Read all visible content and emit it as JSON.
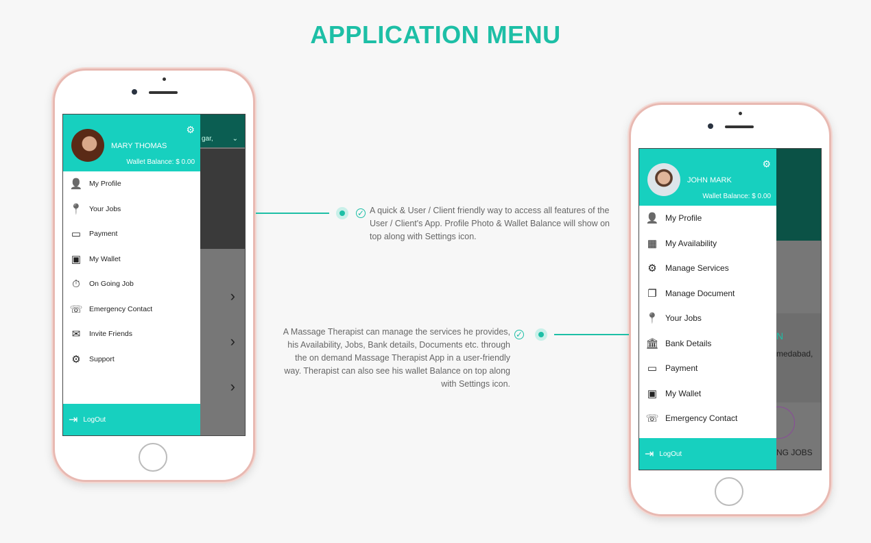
{
  "title": "APPLICATION MENU",
  "colors": {
    "accent": "#17d0bf",
    "title": "#1dbfa6"
  },
  "left_phone": {
    "user_name": "MARY THOMAS",
    "wallet_balance": "Wallet Balance: $ 0.00",
    "settings_icon": "gear-icon",
    "bg_location": "gar,",
    "items": [
      {
        "label": "My Profile",
        "icon": "user-icon"
      },
      {
        "label": "Your Jobs",
        "icon": "map-pin-icon"
      },
      {
        "label": "Payment",
        "icon": "credit-card-icon"
      },
      {
        "label": "My Wallet",
        "icon": "wallet-icon"
      },
      {
        "label": "On Going Job",
        "icon": "stopwatch-icon"
      },
      {
        "label": "Emergency Contact",
        "icon": "phonebook-icon"
      },
      {
        "label": "Invite Friends",
        "icon": "envelope-icon"
      },
      {
        "label": "Support",
        "icon": "support-icon"
      }
    ],
    "logout": "LogOut"
  },
  "right_phone": {
    "user_name": "JOHN MARK",
    "wallet_balance": "Wallet Balance: $ 0.00",
    "settings_icon": "gear-icon",
    "bg_text1": "N",
    "bg_text2": "medabad,",
    "bg_text3": "NG JOBS",
    "items": [
      {
        "label": "My Profile",
        "icon": "user-icon"
      },
      {
        "label": "My Availability",
        "icon": "calendar-icon"
      },
      {
        "label": "Manage Services",
        "icon": "gear-wrench-icon"
      },
      {
        "label": "Manage Document",
        "icon": "document-icon"
      },
      {
        "label": "Your Jobs",
        "icon": "map-pin-icon"
      },
      {
        "label": "Bank Details",
        "icon": "bank-icon"
      },
      {
        "label": "Payment",
        "icon": "credit-card-icon"
      },
      {
        "label": "My Wallet",
        "icon": "wallet-icon"
      },
      {
        "label": "Emergency Contact",
        "icon": "phonebook-icon"
      }
    ],
    "logout": "LogOut"
  },
  "notes": {
    "left": "A quick & User / Client friendly way to access all features of the User / Client's App. Profile Photo & Wallet Balance will show on top along with Settings icon.",
    "right": "A Massage Therapist can manage the services he provides, his Availability, Jobs, Bank details, Documents etc. through the on demand Massage Therapist App in a user-friendly way. Therapist can also see his wallet Balance on top along with Settings icon."
  }
}
